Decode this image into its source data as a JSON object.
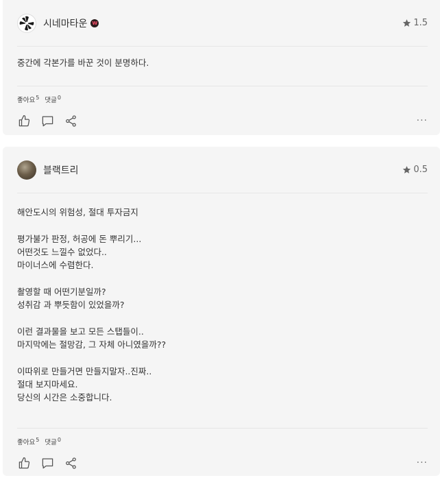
{
  "reviews": [
    {
      "username": "시네마타운",
      "badge_letter": "W",
      "rating": "1.5",
      "text": "중간에 각본가를 바꾼 것이 분명하다.",
      "likes_label": "좋아요",
      "likes_count": "5",
      "comments_label": "댓글",
      "comments_count": "0",
      "avatar_icon": "fan-logo-icon"
    },
    {
      "username": "블랙트리",
      "rating": "0.5",
      "text": "해안도시의 위험성, 절대 투자금지\n\n평가불가 판정, 허공에 돈 뿌리기...\n어떤것도 느낄수 없었다..\n마이너스에 수렴한다.\n\n촬영할 때 어떤기분일까?\n성취감 과 뿌듯함이 있었을까?\n\n이런 결과물을 보고 모든 스탭들이..\n마지막에는 절망감, 그 자체 아니였을까??\n\n이따위로 만들거면 만들지말자..진짜..\n절대 보지마세요.\n당신의 시간은 소중합니다.",
      "likes_label": "좋아요",
      "likes_count": "5",
      "comments_label": "댓글",
      "comments_count": "0",
      "avatar_icon": "tree-photo-avatar"
    }
  ],
  "icons": {
    "star": "star-icon",
    "like": "thumbs-up-icon",
    "comment": "comment-icon",
    "share": "share-icon",
    "more": "more-icon"
  },
  "more_label": "···"
}
